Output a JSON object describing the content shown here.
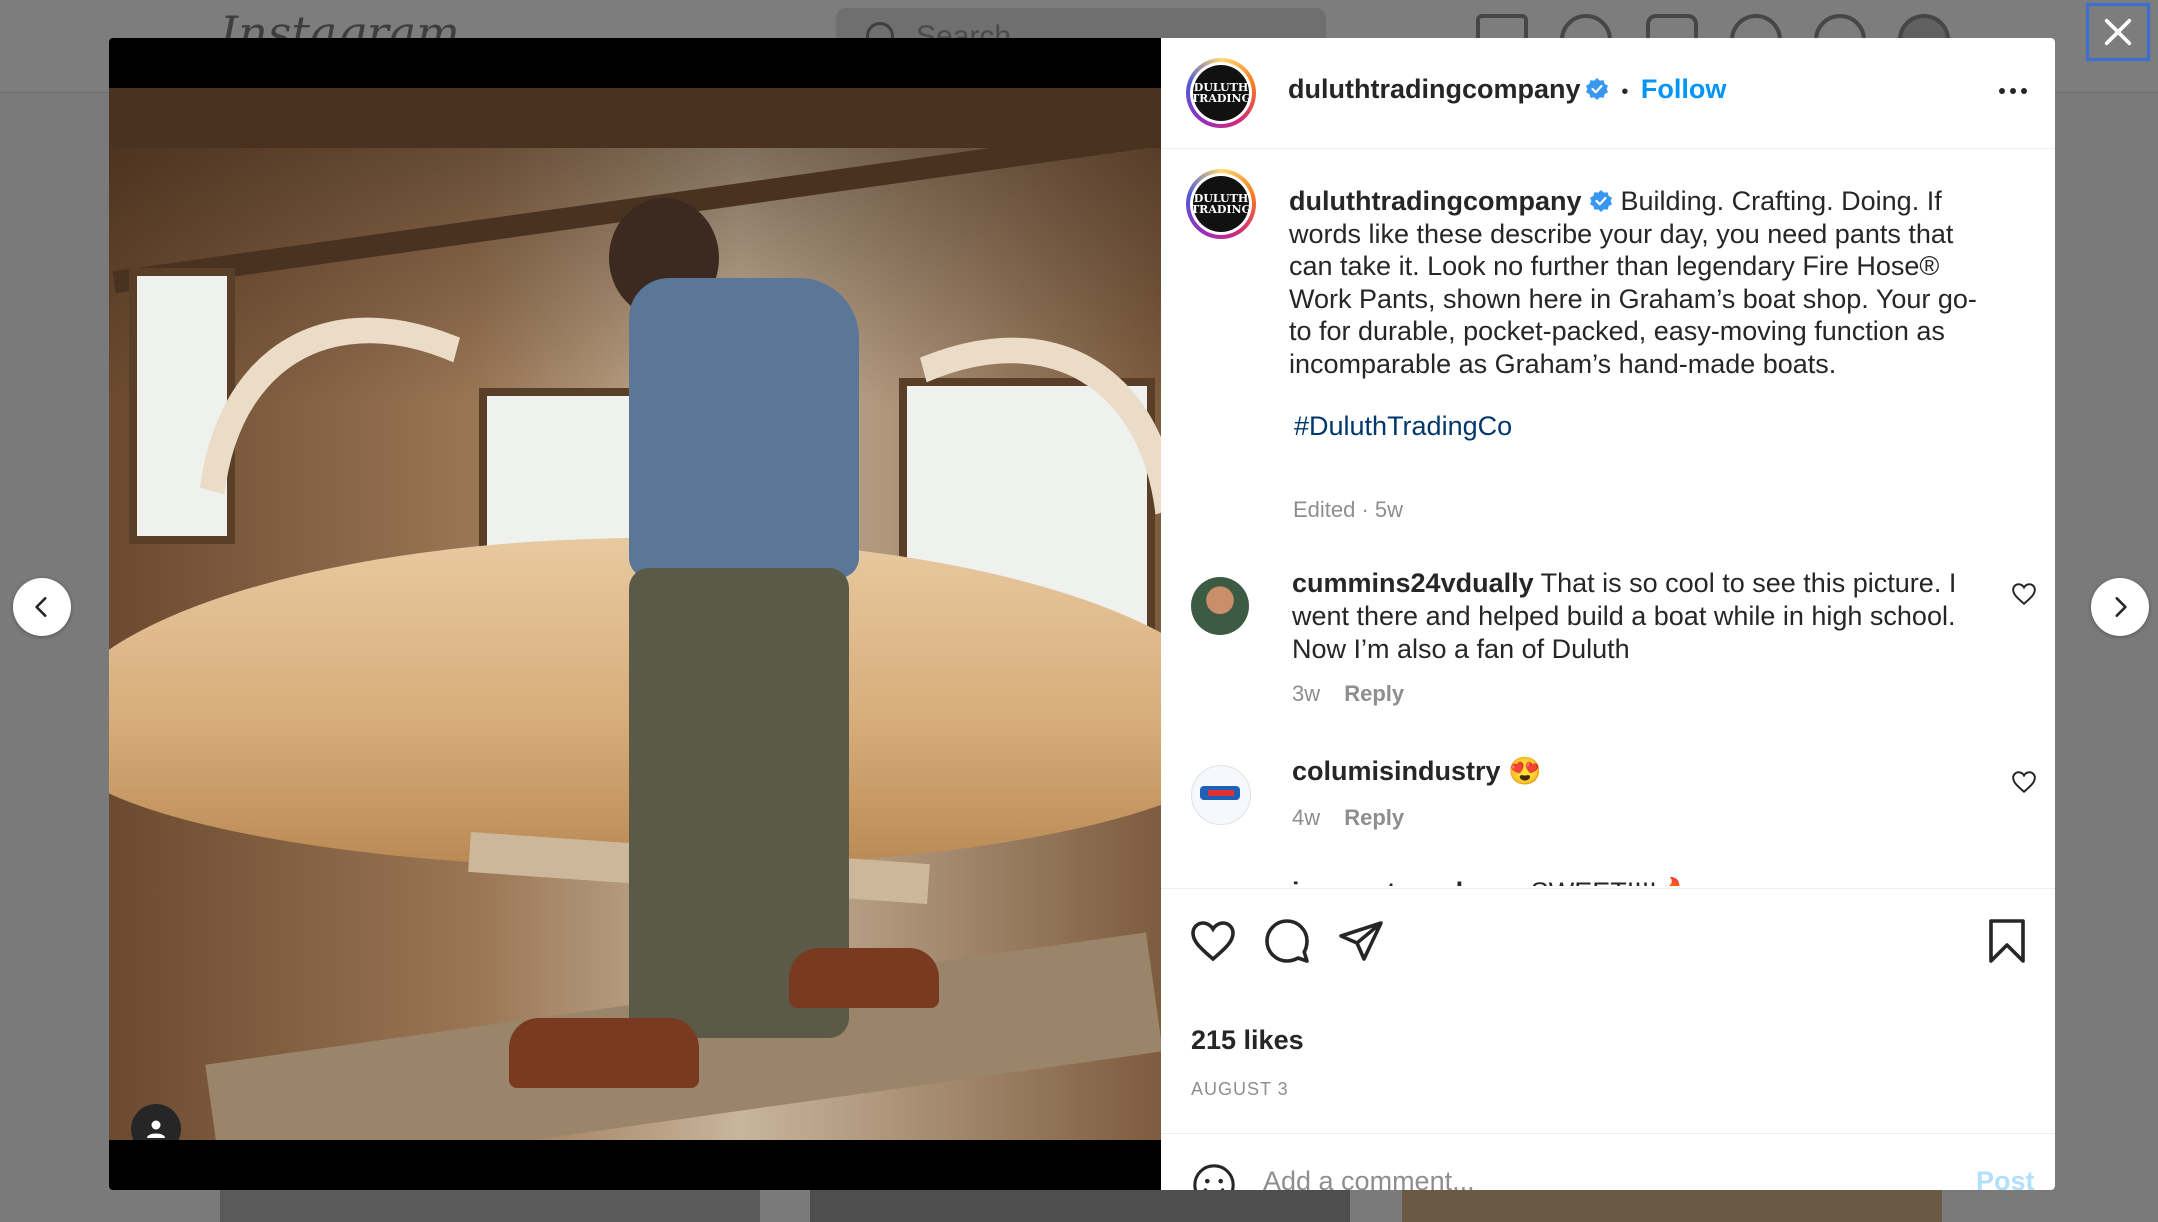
{
  "background": {
    "logo": "Instagram",
    "search_placeholder": "Search"
  },
  "post": {
    "username": "duluthtradingcompany",
    "follow_label": "Follow",
    "separator": "•",
    "more_label": "•••",
    "avatar_logo_text": "DULUTH TRADING",
    "caption": "Building. Crafting. Doing. If words like these describe your day, you need pants that can take it. Look no further than legendary Fire Hose® Work Pants, shown here in Graham’s boat shop. Your go-to for durable, pocket-packed, easy-moving function as incomparable as Graham’s hand-made boats.",
    "hashtag": "#DuluthTradingCo",
    "edited_meta": "Edited · 5w",
    "likes": "215 likes",
    "date": "AUGUST 3",
    "comment_placeholder": "Add a comment...",
    "post_label": "Post"
  },
  "comments": [
    {
      "username": "cummins24vdually",
      "text": "That is so cool to see this picture. I went there and helped build a boat while in high school. Now I’m also a fan of Duluth",
      "age": "3w",
      "reply_label": "Reply"
    },
    {
      "username": "columisindustry",
      "text": "😍",
      "age": "4w",
      "reply_label": "Reply"
    },
    {
      "username": "irene_staysclassy",
      "text": "SWEET!!!!🔥",
      "age": "",
      "reply_label": ""
    }
  ],
  "colors": {
    "accent": "#0095f6",
    "post_disabled": "#b2dffc",
    "verified": "#3897f0"
  }
}
